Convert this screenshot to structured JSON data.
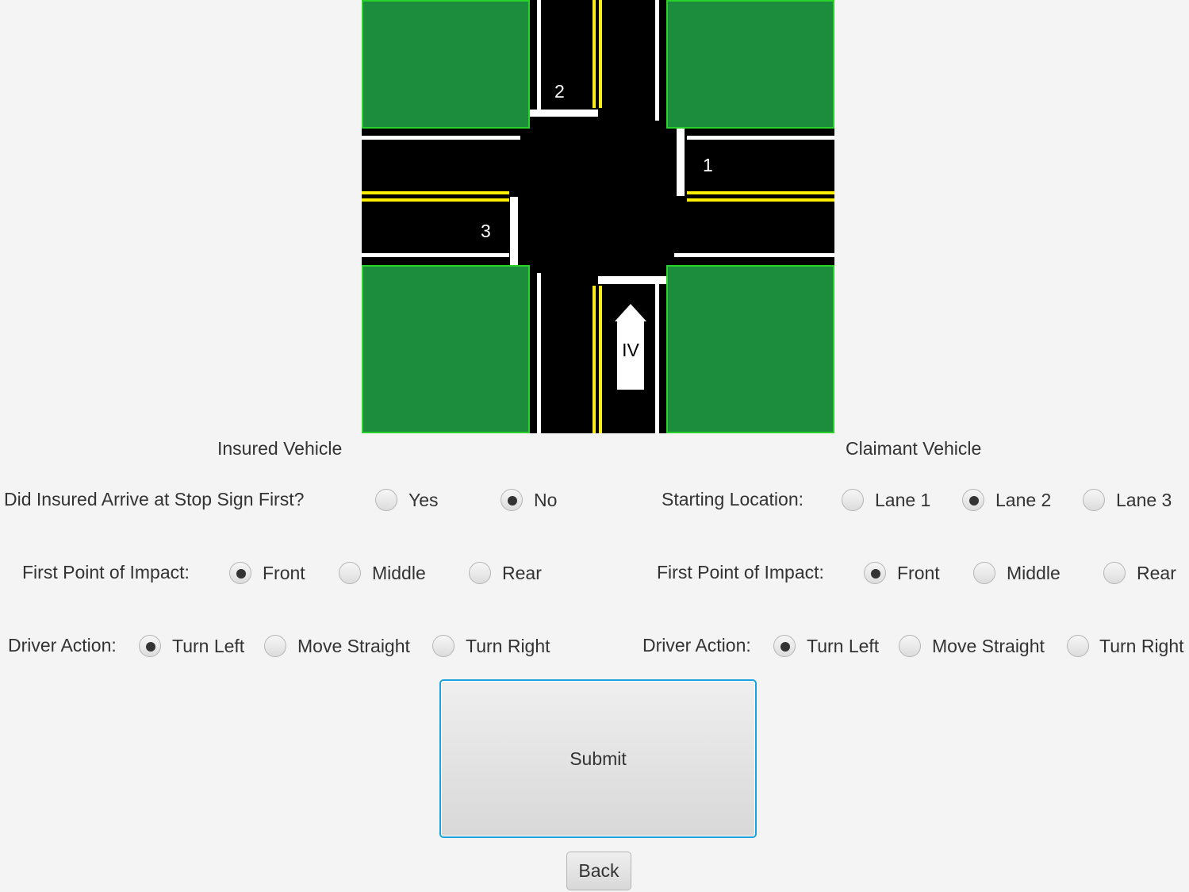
{
  "map": {
    "lane_labels": {
      "lane1": "1",
      "lane2": "2",
      "lane3": "3"
    },
    "insured_marker": "IV",
    "colors": {
      "grass": "#1b8d3c",
      "grass_border": "#2bd12b",
      "road": "#000000",
      "center_line": "#ffee00",
      "edge_line": "#ffffff"
    }
  },
  "headings": {
    "insured": "Insured Vehicle",
    "claimant": "Claimant Vehicle"
  },
  "insured": {
    "stop_sign_question": "Did Insured Arrive at Stop Sign First?",
    "stop_sign_options": [
      "Yes",
      "No"
    ],
    "stop_sign_selected": "No",
    "impact_label": "First Point of Impact:",
    "impact_options": [
      "Front",
      "Middle",
      "Rear"
    ],
    "impact_selected": "Front",
    "action_label": "Driver Action:",
    "action_options": [
      "Turn Left",
      "Move Straight",
      "Turn Right"
    ],
    "action_selected": "Turn Left"
  },
  "claimant": {
    "start_label": "Starting Location:",
    "start_options": [
      "Lane 1",
      "Lane 2",
      "Lane 3"
    ],
    "start_selected": "Lane 2",
    "impact_label": "First Point of Impact:",
    "impact_options": [
      "Front",
      "Middle",
      "Rear"
    ],
    "impact_selected": "Front",
    "action_label": "Driver Action:",
    "action_options": [
      "Turn Left",
      "Move Straight",
      "Turn Right"
    ],
    "action_selected": "Turn Left"
  },
  "buttons": {
    "submit": "Submit",
    "back": "Back"
  },
  "colors": {
    "background": "#f4f4f4",
    "text": "#333333",
    "focus": "#1aa1e0"
  }
}
